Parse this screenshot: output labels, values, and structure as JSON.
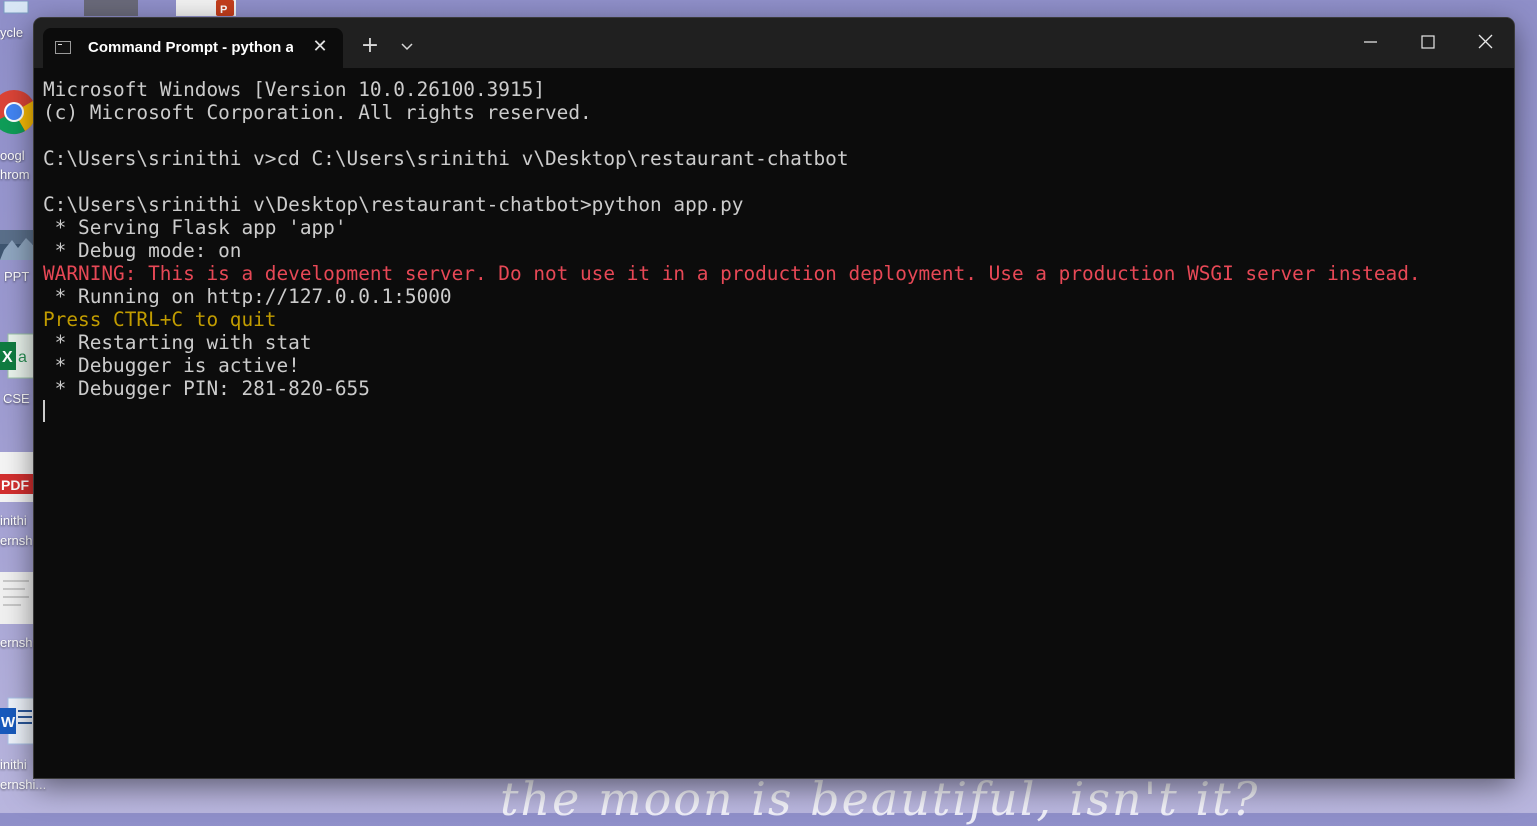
{
  "desktop": {
    "labels": [
      "ycle",
      "oogl",
      "hrom",
      "PPT",
      "CSE",
      "inithi",
      "ernsh",
      "ernsh",
      "inithi",
      "ernshi..."
    ],
    "wallpaper_text": "the moon is beautiful, isn't it?"
  },
  "window": {
    "tab_title": "Command Prompt - python a",
    "tab_close": "✕",
    "new_tab": "+",
    "dropdown": "⌄",
    "minimize": "—",
    "maximize": "☐",
    "close": "✕"
  },
  "terminal": {
    "lines": [
      {
        "text": "Microsoft Windows [Version 10.0.26100.3915]",
        "style": "normal"
      },
      {
        "text": "(c) Microsoft Corporation. All rights reserved.",
        "style": "normal"
      },
      {
        "text": "",
        "style": "normal"
      },
      {
        "text": "C:\\Users\\srinithi v>cd C:\\Users\\srinithi v\\Desktop\\restaurant-chatbot",
        "style": "normal"
      },
      {
        "text": "",
        "style": "normal"
      },
      {
        "text": "C:\\Users\\srinithi v\\Desktop\\restaurant-chatbot>python app.py",
        "style": "normal"
      },
      {
        "text": " * Serving Flask app 'app'",
        "style": "normal"
      },
      {
        "text": " * Debug mode: on",
        "style": "normal"
      },
      {
        "text": "WARNING: This is a development server. Do not use it in a production deployment. Use a production WSGI server instead.",
        "style": "warn"
      },
      {
        "text": " * Running on http://127.0.0.1:5000",
        "style": "normal"
      },
      {
        "text": "Press CTRL+C to quit",
        "style": "yellow"
      },
      {
        "text": " * Restarting with stat",
        "style": "normal"
      },
      {
        "text": " * Debugger is active!",
        "style": "normal"
      },
      {
        "text": " * Debugger PIN: 281-820-655",
        "style": "normal"
      }
    ]
  }
}
